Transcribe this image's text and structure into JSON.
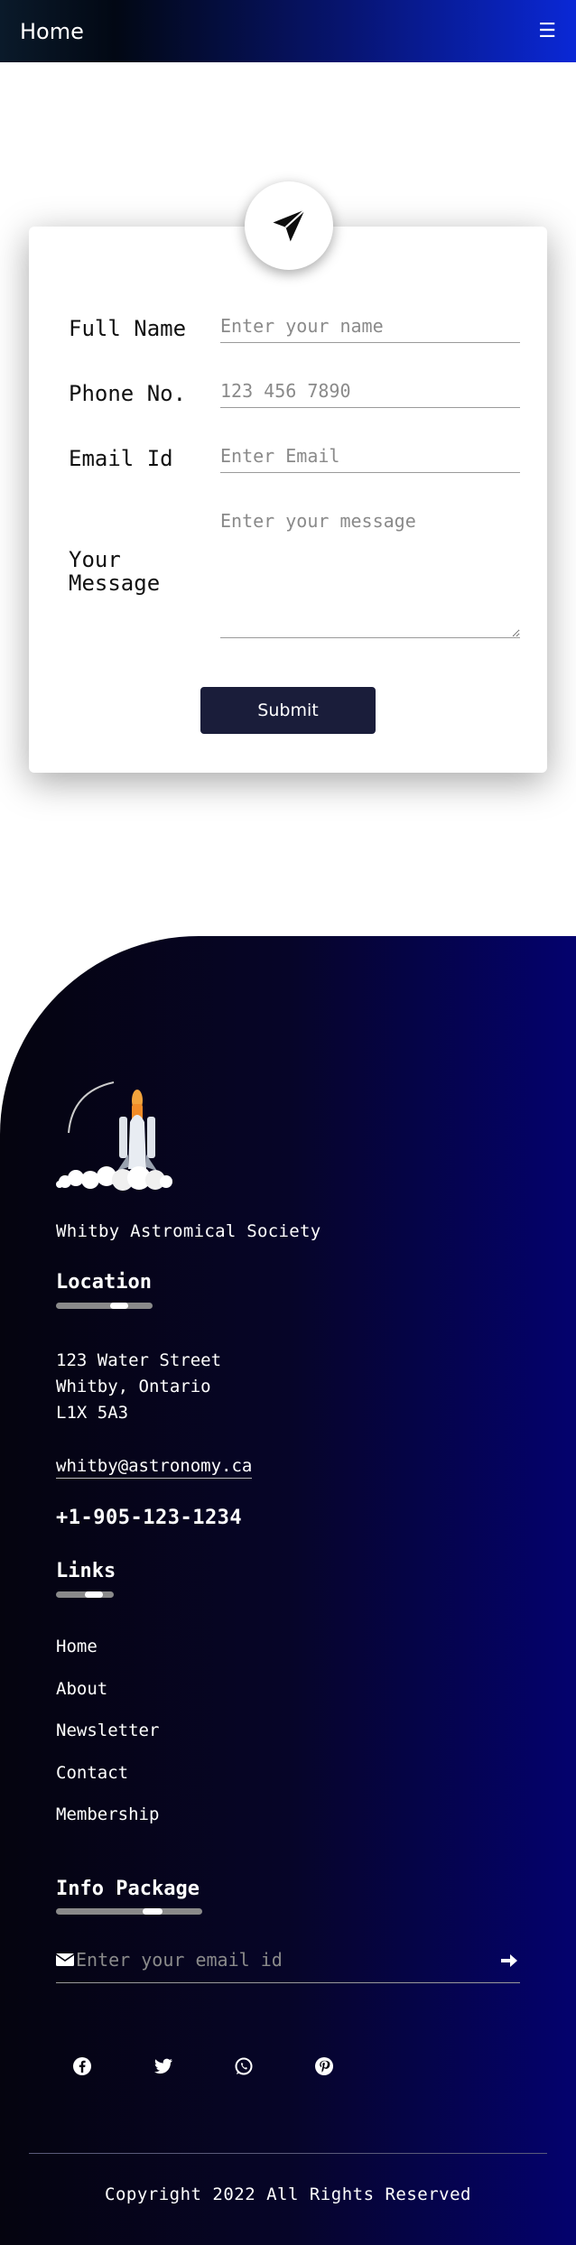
{
  "header": {
    "home_label": "Home",
    "menu_icon": "☰"
  },
  "form": {
    "fields": [
      {
        "label": "Full Name",
        "placeholder": "Enter your name"
      },
      {
        "label": "Phone No.",
        "placeholder": "123 456 7890"
      },
      {
        "label": "Email Id",
        "placeholder": "Enter Email"
      },
      {
        "label": "Your Message",
        "placeholder": "Enter your message"
      }
    ],
    "submit_label": "Submit",
    "badge_icon": "paper-plane-icon"
  },
  "footer": {
    "org_name": "Whitby Astromical Society",
    "location": {
      "title": "Location",
      "address_line1": "123 Water Street",
      "address_line2": "Whitby, Ontario",
      "address_line3": "L1X 5A3",
      "email": "whitby@astronomy.ca",
      "phone": "+1-905-123-1234"
    },
    "links": {
      "title": "Links",
      "items": [
        "Home",
        "About",
        "Newsletter",
        "Contact",
        "Membership"
      ]
    },
    "info_package": {
      "title": "Info Package",
      "email_placeholder": "Enter your email id"
    },
    "social_icons": [
      "facebook-icon",
      "twitter-icon",
      "whatsapp-icon",
      "pinterest-icon"
    ],
    "copyright": "Copyright 2022 All Rights Reserved"
  }
}
